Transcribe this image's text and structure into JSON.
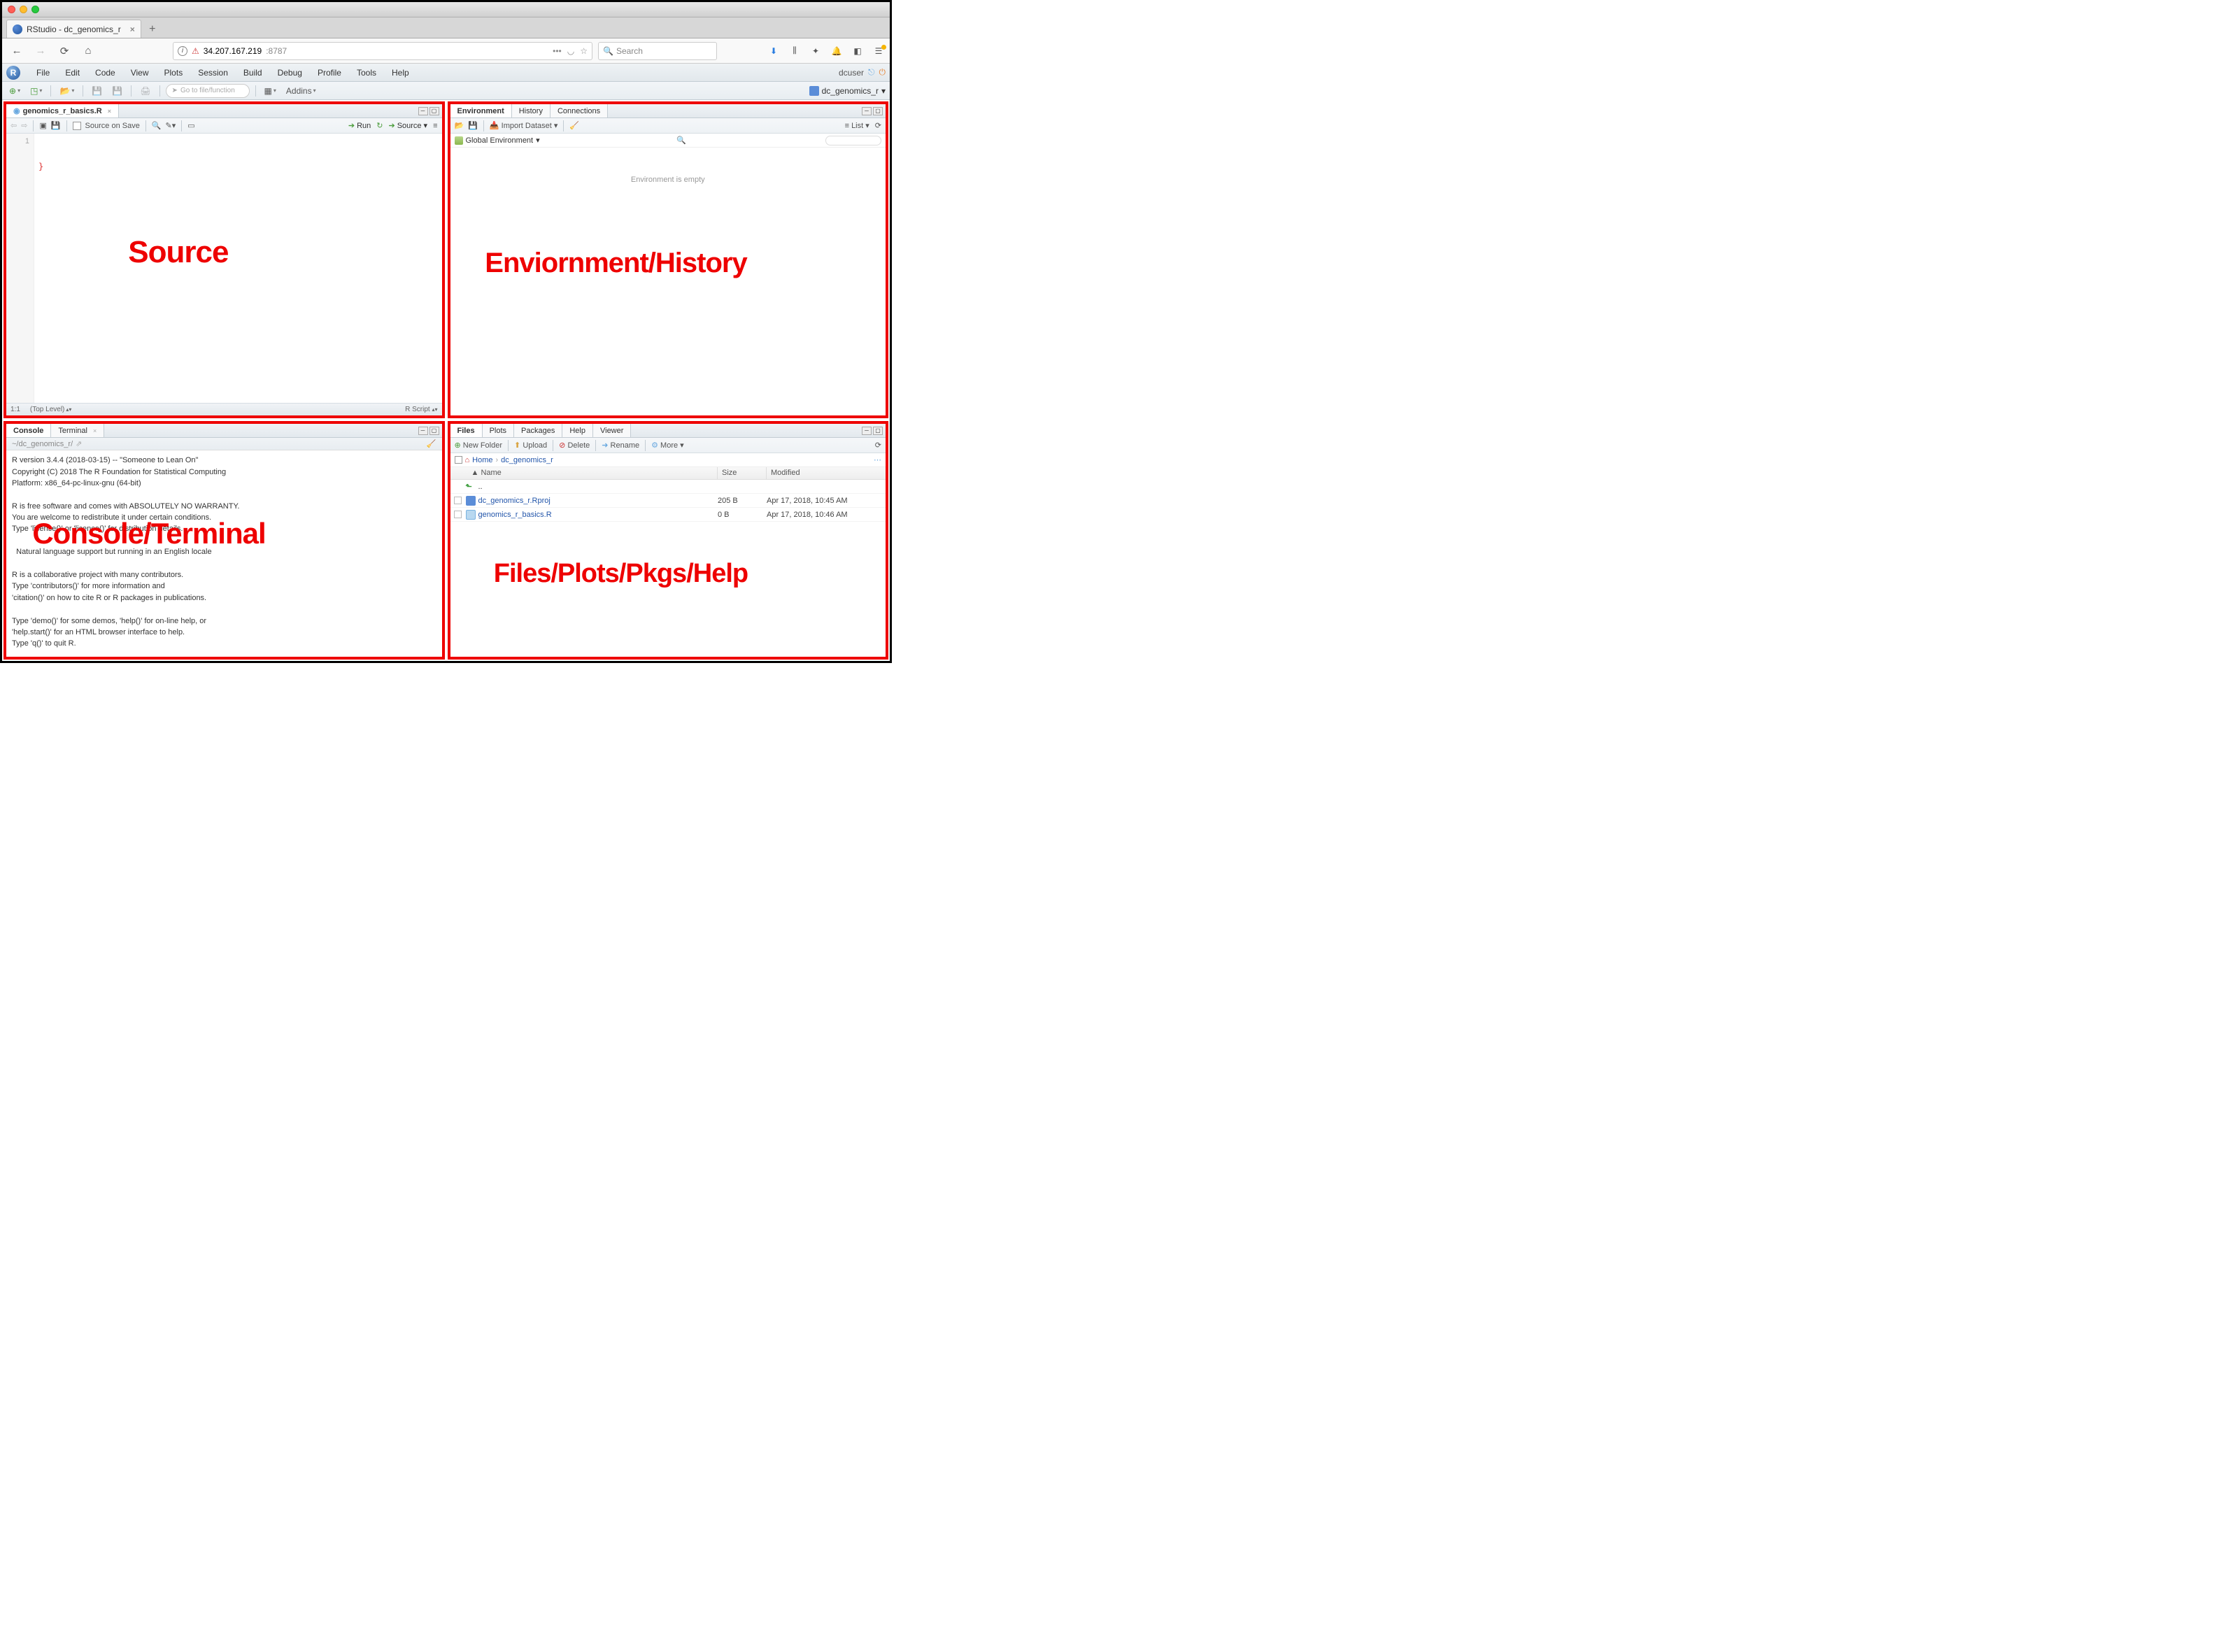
{
  "mac": {
    "title": ""
  },
  "browser": {
    "tab_title": "RStudio - dc_genomics_r",
    "url_host": "34.207.167.219",
    "url_port": ":8787",
    "search_placeholder": "Search"
  },
  "rstudio": {
    "menus": [
      "File",
      "Edit",
      "Code",
      "View",
      "Plots",
      "Session",
      "Build",
      "Debug",
      "Profile",
      "Tools",
      "Help"
    ],
    "user": "dcuser",
    "project": "dc_genomics_r",
    "toolbar": {
      "goto_placeholder": "Go to file/function",
      "addins": "Addins"
    }
  },
  "source": {
    "filename": "genomics_r_basics.R",
    "source_on_save": "Source on Save",
    "run": "Run",
    "source_btn": "Source",
    "line1": "1",
    "status_pos": "1:1",
    "status_scope": "(Top Level)",
    "status_lang": "R Script"
  },
  "env": {
    "tabs": [
      "Environment",
      "History",
      "Connections"
    ],
    "import": "Import Dataset",
    "list": "List",
    "scope": "Global Environment",
    "empty": "Environment is empty"
  },
  "console": {
    "tabs": [
      "Console",
      "Terminal"
    ],
    "path": "~/dc_genomics_r/",
    "text": "R version 3.4.4 (2018-03-15) -- \"Someone to Lean On\"\nCopyright (C) 2018 The R Foundation for Statistical Computing\nPlatform: x86_64-pc-linux-gnu (64-bit)\n\nR is free software and comes with ABSOLUTELY NO WARRANTY.\nYou are welcome to redistribute it under certain conditions.\nType 'license()' or 'licence()' for distribution details.\n\n  Natural language support but running in an English locale\n\nR is a collaborative project with many contributors.\nType 'contributors()' for more information and\n'citation()' on how to cite R or R packages in publications.\n\nType 'demo()' for some demos, 'help()' for on-line help, or\n'help.start()' for an HTML browser interface to help.\nType 'q()' to quit R.\n",
    "prompt": ">"
  },
  "files": {
    "tabs": [
      "Files",
      "Plots",
      "Packages",
      "Help",
      "Viewer"
    ],
    "toolbar": {
      "newfolder": "New Folder",
      "upload": "Upload",
      "delete": "Delete",
      "rename": "Rename",
      "more": "More"
    },
    "breadcrumb": {
      "home": "Home",
      "proj": "dc_genomics_r"
    },
    "headers": {
      "name": "Name",
      "size": "Size",
      "modified": "Modified"
    },
    "rows": [
      {
        "name": "..",
        "size": "",
        "modified": "",
        "type": "up"
      },
      {
        "name": "dc_genomics_r.Rproj",
        "size": "205 B",
        "modified": "Apr 17, 2018, 10:45 AM",
        "type": "proj"
      },
      {
        "name": "genomics_r_basics.R",
        "size": "0 B",
        "modified": "Apr 17, 2018, 10:46 AM",
        "type": "r"
      }
    ]
  },
  "overlays": {
    "source": "Source",
    "env": "Enviornment/History",
    "console": "Console/Terminal",
    "files": "Files/Plots/Pkgs/Help"
  }
}
